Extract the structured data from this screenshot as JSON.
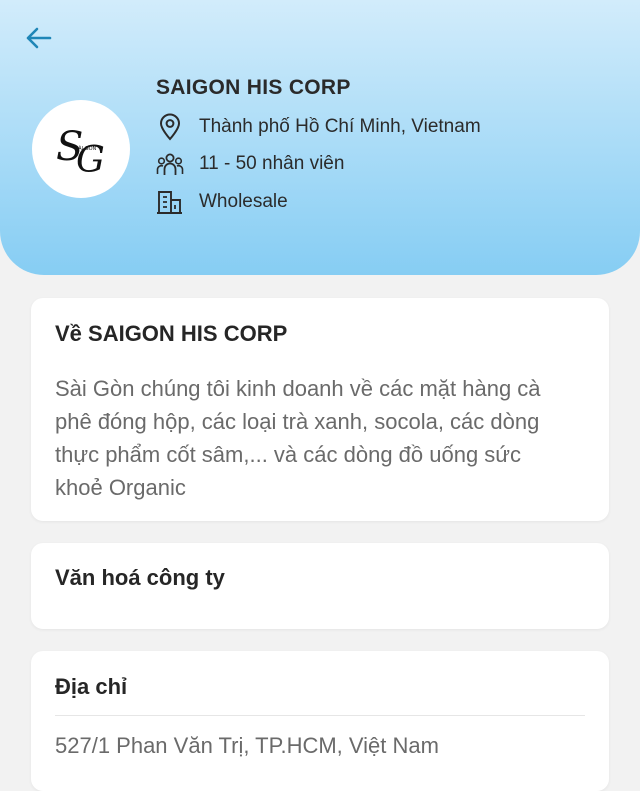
{
  "colors": {
    "header_top": "#d2ecfb",
    "header_bottom": "#86cdf3",
    "accent": "#1f86b7",
    "background": "#f2f2f2"
  },
  "header": {
    "back_icon": "arrow-left-icon",
    "logo": {
      "icon": "company-logo",
      "monogram": "SG",
      "tagline": "SÀI GÒN"
    },
    "company_name": "SAIGON HIS CORP",
    "location": {
      "icon": "map-pin-icon",
      "text": "Thành phố Hồ Chí Minh, Vietnam"
    },
    "employees": {
      "icon": "people-icon",
      "text": "11 - 50 nhân viên"
    },
    "industry": {
      "icon": "building-icon",
      "text": "Wholesale"
    }
  },
  "about": {
    "title": "Về SAIGON HIS CORP",
    "lines": [
      "Sài Gòn chúng tôi kinh doanh về các mặt hàng cà",
      "phê đóng hộp, các loại trà xanh, socola, các dòng",
      "thực phẩm cốt sâm,... và các dòng đồ uống sức",
      "khoẻ Organic"
    ]
  },
  "culture": {
    "title": "Văn hoá công ty"
  },
  "address": {
    "title": "Địa chỉ",
    "value": "527/1 Phan Văn Trị, TP.HCM, Việt Nam"
  }
}
